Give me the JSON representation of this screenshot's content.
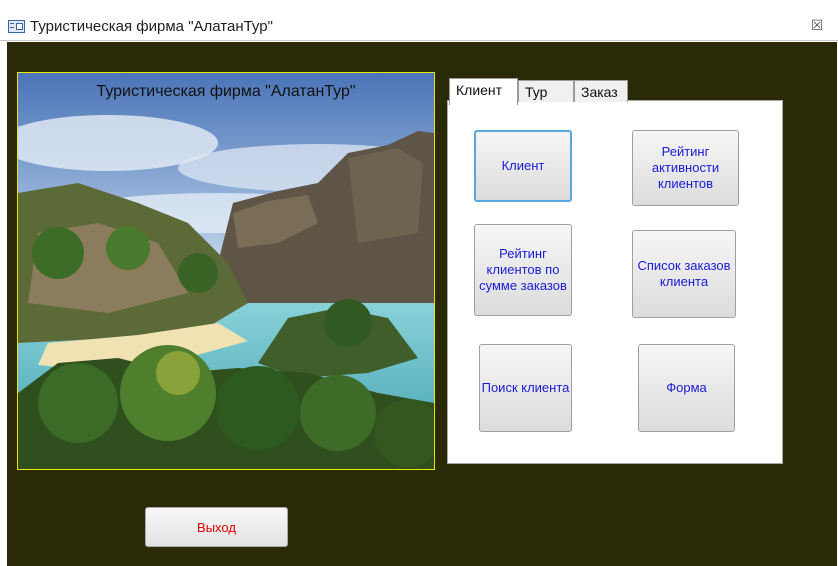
{
  "window": {
    "title": "Туристическая фирма \"АлатанТур\"",
    "close_glyph": "☒"
  },
  "picture": {
    "caption": "Туристическая фирма \"АлатанТур\""
  },
  "tabs": [
    {
      "label": "Клиент",
      "active": true
    },
    {
      "label": "Тур",
      "active": false
    },
    {
      "label": "Заказ",
      "active": false
    }
  ],
  "buttons": {
    "client": "Клиент",
    "activity_rating": "Рейтинг активности клиентов",
    "order_sum_rating": "Рейтинг клиентов по сумме заказов",
    "client_orders_list": "Список заказов клиента",
    "client_search": "Поиск клиента",
    "form": "Форма"
  },
  "exit_button": "Выход",
  "colors": {
    "form_background": "#2b2a08",
    "button_text": "#1a1ad6",
    "exit_text": "#e00000",
    "frame_border": "#e6e600"
  }
}
